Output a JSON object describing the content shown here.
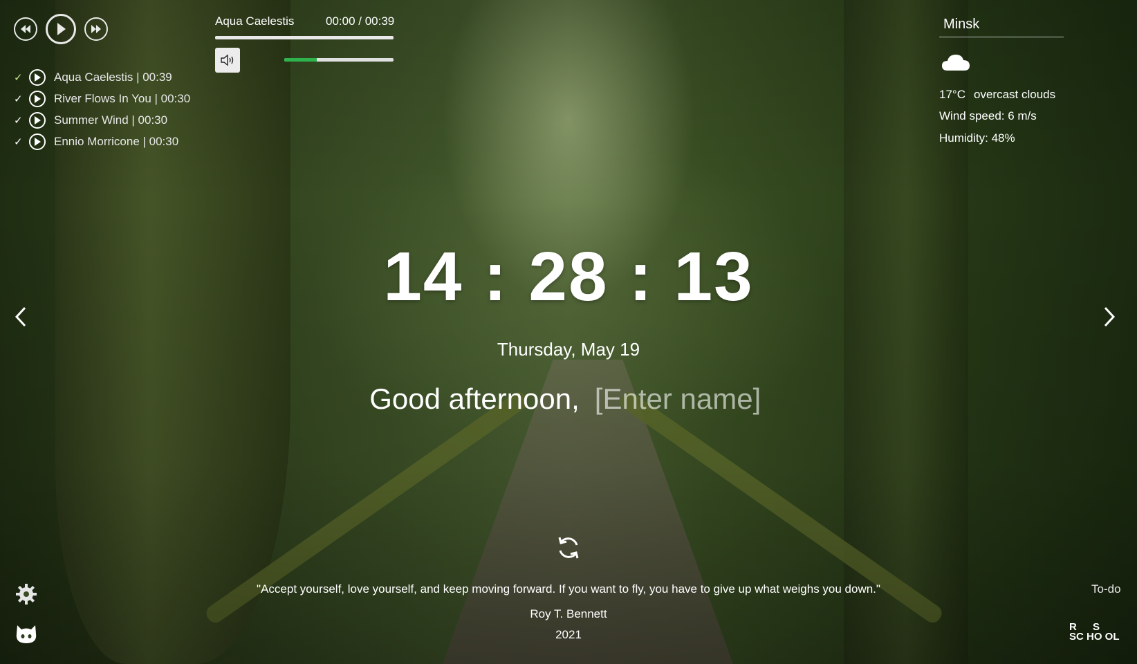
{
  "player": {
    "current_title": "Aqua Caelestis",
    "time": "00:00 / 00:39",
    "progress_fraction": 0.0,
    "volume_fraction": 0.3,
    "playlist": [
      {
        "label": "Aqua Caelestis | 00:39"
      },
      {
        "label": "River Flows In You | 00:30"
      },
      {
        "label": "Summer Wind | 00:30"
      },
      {
        "label": "Ennio Morricone | 00:30"
      }
    ],
    "check_mark": "✓"
  },
  "weather": {
    "city": "Minsk",
    "icon": "cloud-icon",
    "temperature": "17°C",
    "description": "overcast clouds",
    "wind": "Wind speed: 6 m/s",
    "humidity": "Humidity: 48%"
  },
  "clock": {
    "time": "14 : 28 : 13",
    "date": "Thursday, May 19"
  },
  "greeting": {
    "text": "Good afternoon,",
    "name_placeholder": "[Enter name]",
    "name_value": ""
  },
  "quote": {
    "text": "\"Accept yourself, love yourself, and keep moving forward. If you want to fly, you have to give up what weighs you down.\"",
    "author": "Roy T. Bennett",
    "year": "2021"
  },
  "footer": {
    "todo_label": "To-do",
    "logo_text": "RS SCHOOL"
  },
  "colors": {
    "volume_fill": "#2fb44d",
    "text": "#ffffff"
  }
}
